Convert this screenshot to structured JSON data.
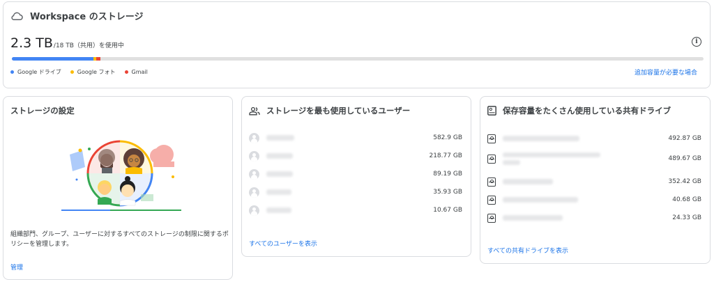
{
  "storage": {
    "title": "Workspace のストレージ",
    "used": "2.3 TB",
    "total_text": "/18 TB（共用）を使用中",
    "bar": [
      {
        "name": "Google ドライブ",
        "fraction": 0.118,
        "color": "#4285f4"
      },
      {
        "name": "Google フォト",
        "fraction": 0.004,
        "color": "#fbbc04"
      },
      {
        "name": "Gmail",
        "fraction": 0.006,
        "color": "#ea4335"
      }
    ],
    "legend": [
      "Google ドライブ",
      "Google フォト",
      "Gmail"
    ],
    "more_link": "追加容量が必要な場合",
    "info_icon": "info-icon"
  },
  "settings": {
    "title": "ストレージの設定",
    "description": "組織部門、グループ、ユーザーに対するすべてのストレージの制限に関するポリシーを管理します。",
    "manage_link": "管理"
  },
  "users": {
    "title": "ストレージを最も使用しているユーザー",
    "rows": [
      {
        "value": "582.9 GB"
      },
      {
        "value": "218.77 GB"
      },
      {
        "value": "89.19 GB"
      },
      {
        "value": "35.93 GB"
      },
      {
        "value": "10.67 GB"
      }
    ],
    "link": "すべてのユーザーを表示"
  },
  "drives": {
    "title": "保存容量をたくさん使用している共有ドライブ",
    "rows": [
      {
        "value": "492.87 GB"
      },
      {
        "value": "489.67 GB"
      },
      {
        "value": "352.42 GB"
      },
      {
        "value": "40.68 GB"
      },
      {
        "value": "24.33 GB"
      }
    ],
    "link": "すべての共有ドライブを表示"
  }
}
